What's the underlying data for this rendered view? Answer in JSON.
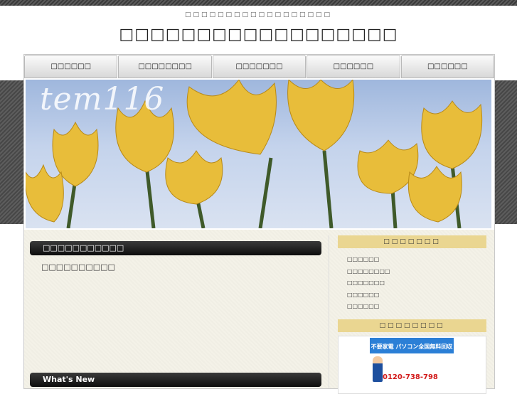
{
  "header": {
    "description": "□□□□□□□□□□□□□□□□□□",
    "title": "□□□□□□□□□□□□□□□□□□"
  },
  "nav": {
    "items": [
      "□□□□□□",
      "□□□□□□□□",
      "□□□□□□□",
      "□□□□□□",
      "□□□□□□"
    ]
  },
  "banner": {
    "logo_text": "tem116"
  },
  "main": {
    "section_title": "□□□□□□□□□□□",
    "intro": "□□□□□□□□□□",
    "whats_new_title": "What's New"
  },
  "sidebar": {
    "menu_title": "□□□□□□□",
    "menu_items": [
      "□□□□□□",
      "□□□□□□□□",
      "□□□□□□□",
      "□□□□□□",
      "□□□□□□"
    ],
    "ad_title": "□□□□□□□□",
    "ad_headline": "不要家電 パソコン全国無料回収",
    "ad_phone": "0120-738-798"
  },
  "colors": {
    "sidebar_header_bg": "#ead691",
    "title_bar_bg": "#111111",
    "content_bg": "#f4f2e8"
  }
}
